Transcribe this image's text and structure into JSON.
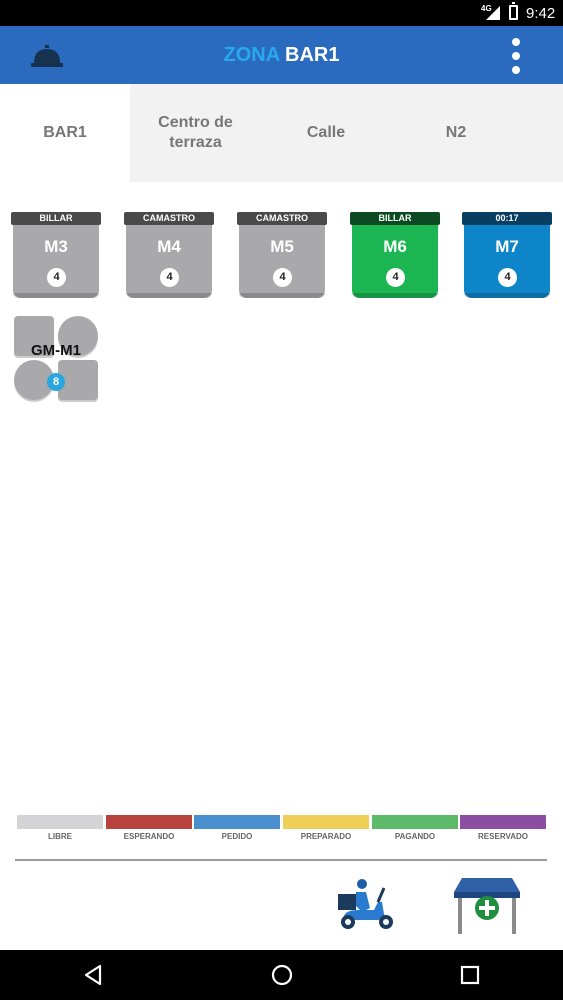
{
  "status_bar": {
    "network": "4G",
    "time": "9:42"
  },
  "app_bar": {
    "title_prefix": "ZONA",
    "title_main": " BAR1",
    "title_prefix_color": "#29a8f0",
    "background_color": "#2a6bbf",
    "left_icon": "service-bell-icon",
    "right_icon": "more-vert-icon"
  },
  "tabs": [
    {
      "label": "BAR1",
      "active": true
    },
    {
      "label": "Centro de terraza",
      "active": false
    },
    {
      "label": "Calle",
      "active": false
    },
    {
      "label": "N2",
      "active": false
    }
  ],
  "tables": [
    {
      "tag": "BILLAR",
      "name": "M3",
      "seats": "4",
      "color": "#a9a9ab"
    },
    {
      "tag": "CAMASTRO",
      "name": "M4",
      "seats": "4",
      "color": "#a9a9ab"
    },
    {
      "tag": "CAMASTRO",
      "name": "M5",
      "seats": "4",
      "color": "#a9a9ab"
    },
    {
      "tag": "BILLAR",
      "name": "M6",
      "seats": "4",
      "color": "#1bb552"
    },
    {
      "tag": "00:17",
      "name": "M7",
      "seats": "4",
      "color": "#0e85c8"
    }
  ],
  "group_table": {
    "name": "GM-M1",
    "seats": "8"
  },
  "legend": [
    {
      "label": "LIBRE",
      "color": "#d4d4d6"
    },
    {
      "label": "ESPERANDO",
      "color": "#b8433d"
    },
    {
      "label": "PEDIDO",
      "color": "#4a90cf"
    },
    {
      "label": "PREPARADO",
      "color": "#f0cf59"
    },
    {
      "label": "PAGANDO",
      "color": "#5cba6a"
    },
    {
      "label": "RESERVADO",
      "color": "#8c4ea4"
    }
  ],
  "actions": {
    "delivery_icon": "delivery-scooter-icon",
    "add_table_icon": "add-table-icon"
  },
  "nav": {
    "back_icon": "back-triangle-icon",
    "home_icon": "home-circle-icon",
    "recents_icon": "recents-square-icon"
  }
}
